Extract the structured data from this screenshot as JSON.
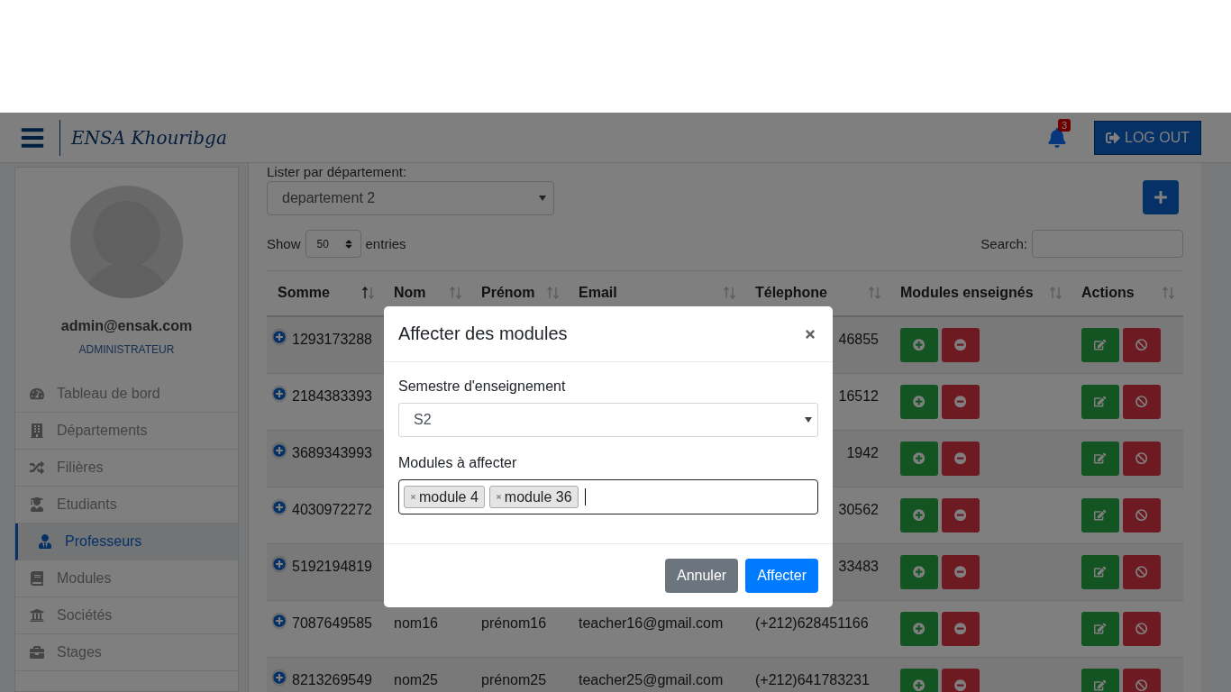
{
  "header": {
    "brand": "ENSA Khouribga",
    "notifications": "3",
    "logout": "LOG OUT"
  },
  "sidebar": {
    "email": "admin@ensak.com",
    "role": "ADMINISTRATEUR",
    "items": [
      {
        "label": "Tableau de bord",
        "selected": false
      },
      {
        "label": "Départements",
        "selected": false
      },
      {
        "label": "Filières",
        "selected": false
      },
      {
        "label": "Etudiants",
        "selected": false
      },
      {
        "label": "Professeurs",
        "selected": true
      },
      {
        "label": "Modules",
        "selected": false
      },
      {
        "label": "Sociétés",
        "selected": false
      },
      {
        "label": "Stages",
        "selected": false
      }
    ]
  },
  "filter": {
    "label": "Lister par département:",
    "value": "departement 2"
  },
  "table": {
    "show": "Show",
    "length": "50",
    "entries": "entries",
    "search_label": "Search:",
    "columns": [
      {
        "label": "Somme",
        "sorted": true
      },
      {
        "label": "Nom",
        "sorted": false
      },
      {
        "label": "Prénom",
        "sorted": false
      },
      {
        "label": "Email",
        "sorted": false
      },
      {
        "label": "Télephone",
        "sorted": false
      },
      {
        "label": "Modules enseignés",
        "sorted": false
      },
      {
        "label": "Actions",
        "sorted": false
      }
    ],
    "rows": [
      {
        "kind": "covered",
        "somme": "1293173288",
        "telephone": "46855"
      },
      {
        "kind": "covered",
        "somme": "2184383393",
        "telephone": "16512"
      },
      {
        "kind": "covered",
        "somme": "3689343993",
        "telephone": "1942"
      },
      {
        "kind": "covered",
        "somme": "4030972272",
        "telephone": "30562"
      },
      {
        "kind": "covered",
        "somme": "5192194819",
        "telephone": "33483"
      },
      {
        "kind": "full",
        "somme": "7087649585",
        "nom": "nom16",
        "prenom": "prénom16",
        "email": "teacher16@gmail.com",
        "telephone": "(+212)628451166"
      },
      {
        "kind": "full",
        "somme": "8213269549",
        "nom": "nom25",
        "prenom": "prénom25",
        "email": "teacher25@gmail.com",
        "telephone": "(+212)641783231"
      }
    ]
  },
  "modal": {
    "title": "Affecter des modules",
    "semester_label": "Semestre d'enseignement",
    "semester": "S2",
    "modules_label": "Modules à affecter",
    "modules": [
      "module 4",
      "module 36"
    ],
    "cancel": "Annuler",
    "submit": "Affecter"
  }
}
